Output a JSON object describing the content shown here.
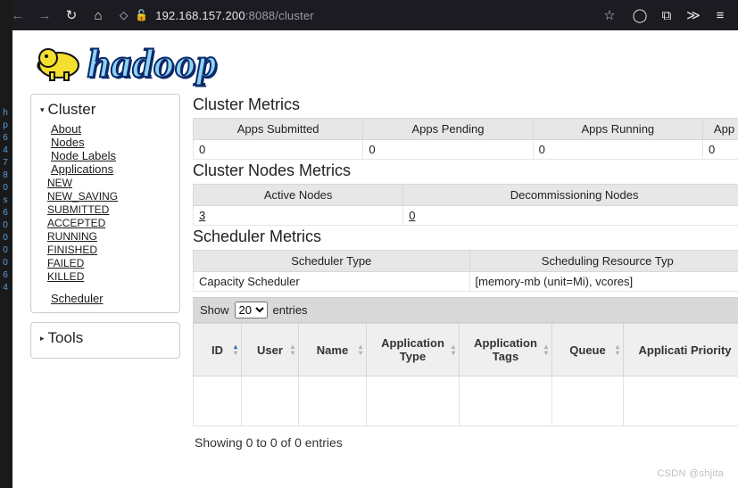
{
  "browser": {
    "shield_icon": "◇",
    "lock_icon": "🔒",
    "url_host": "192.168.157.200",
    "url_rest": ":8088/cluster"
  },
  "logo": {
    "text": "hadoop"
  },
  "sidebar": {
    "cluster_label": "Cluster",
    "items": [
      "About",
      "Nodes",
      "Node Labels",
      "Applications"
    ],
    "app_states": [
      "NEW",
      "NEW_SAVING",
      "SUBMITTED",
      "ACCEPTED",
      "RUNNING",
      "FINISHED",
      "FAILED",
      "KILLED"
    ],
    "scheduler_label": "Scheduler",
    "tools_label": "Tools"
  },
  "cluster_metrics": {
    "title": "Cluster Metrics",
    "cols": [
      "Apps Submitted",
      "Apps Pending",
      "Apps Running",
      "App"
    ],
    "row": [
      "0",
      "0",
      "0",
      "0"
    ]
  },
  "nodes_metrics": {
    "title": "Cluster Nodes Metrics",
    "cols": [
      "Active Nodes",
      "Decommissioning Nodes"
    ],
    "row": [
      "3",
      "0"
    ]
  },
  "scheduler_metrics": {
    "title": "Scheduler Metrics",
    "cols": [
      "Scheduler Type",
      "Scheduling Resource Typ"
    ],
    "row": [
      "Capacity Scheduler",
      "[memory-mb (unit=Mi), vcores]"
    ]
  },
  "apps_table": {
    "show_label_pre": "Show",
    "show_label_post": "entries",
    "show_value": "20",
    "cols": [
      "ID",
      "User",
      "Name",
      "Application Type",
      "Application Tags",
      "Queue",
      "Applicati Priority"
    ],
    "info": "Showing 0 to 0 of 0 entries"
  },
  "watermark": "CSDN @shjita"
}
